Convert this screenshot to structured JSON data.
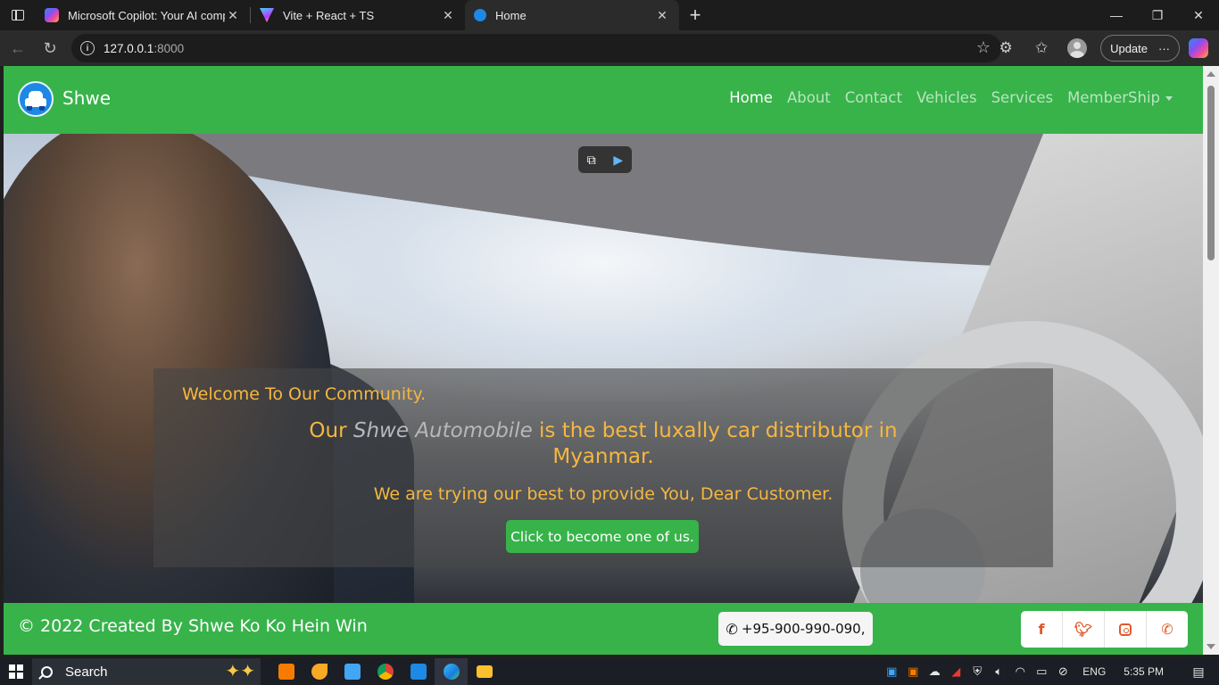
{
  "browser": {
    "tabs": [
      {
        "title": "Microsoft Copilot: Your AI companion",
        "favicon": "copilot-icon",
        "close": "✕"
      },
      {
        "title": "Vite + React + TS",
        "favicon": "vite-icon",
        "close": "✕"
      },
      {
        "title": "Home",
        "favicon": "site-icon",
        "close": "✕"
      }
    ],
    "new_tab": "+",
    "window_controls": {
      "minimize": "—",
      "restore": "❐",
      "close": "✕"
    },
    "address": {
      "host": "127.0.0.1",
      "port": ":8000"
    },
    "update_label": "Update",
    "more_label": "···"
  },
  "site": {
    "brand": "Shwe",
    "nav": [
      {
        "label": "Home",
        "active": true
      },
      {
        "label": "About",
        "active": false
      },
      {
        "label": "Contact",
        "active": false
      },
      {
        "label": "Vehicles",
        "active": false
      },
      {
        "label": "Services",
        "active": false
      },
      {
        "label": "MemberShip",
        "active": false
      }
    ],
    "hero": {
      "welcome": "Welcome To Our Community.",
      "headline_pre": "Our ",
      "headline_em": "Shwe Automobile",
      "headline_post": " is the best luxally car distributor in Myanmar.",
      "subline": "We are trying our best to provide You, Dear Customer.",
      "cta": "Click to become one of us."
    },
    "footer": {
      "copyright": "© 2022 Created By Shwe Ko Ko Hein Win",
      "phone": "+95-900-990-090,",
      "socials": [
        "facebook-icon",
        "twitter-icon",
        "instagram-icon",
        "whatsapp-icon"
      ]
    }
  },
  "taskbar": {
    "search_placeholder": "Search",
    "language": "ENG",
    "time": "5:35 PM"
  },
  "colors": {
    "brand_green": "#37b34a",
    "accent_gold": "#f5b740",
    "social_orange": "#e05a2b"
  }
}
